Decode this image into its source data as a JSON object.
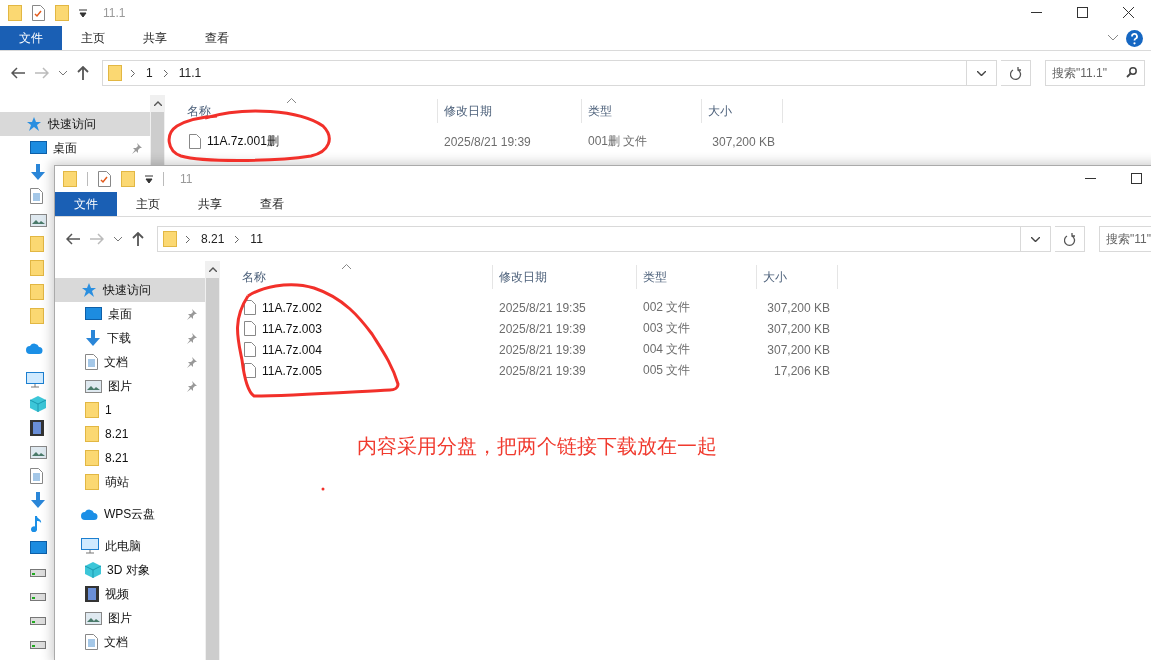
{
  "windows": [
    {
      "title": "11.1",
      "ribbon_tabs": [
        {
          "label": "文件",
          "selected": true
        },
        {
          "label": "主页",
          "selected": false
        },
        {
          "label": "共享",
          "selected": false
        },
        {
          "label": "查看",
          "selected": false
        }
      ],
      "path": [
        "1",
        "11.1"
      ],
      "search": {
        "placeholder": "搜索\"11.1\""
      },
      "sidebar": [
        {
          "kind": "star",
          "label": "快速访问",
          "selected": true,
          "children": [
            {
              "kind": "desktop",
              "label": "桌面",
              "selected": false,
              "pinned": true
            },
            {
              "kind": "download",
              "selected": false
            },
            {
              "kind": "doc",
              "selected": false
            },
            {
              "kind": "picture",
              "selected": false
            },
            {
              "kind": "folder",
              "selected": false
            },
            {
              "kind": "folder",
              "selected": false
            },
            {
              "kind": "folder",
              "selected": false
            },
            {
              "kind": "folder",
              "selected": false
            }
          ]
        },
        {
          "kind": "cloud",
          "selected": false
        },
        {
          "kind": "pc",
          "selected": false,
          "children": [
            {
              "kind": "cube",
              "selected": false
            },
            {
              "kind": "video",
              "selected": false
            },
            {
              "kind": "picture",
              "selected": false
            },
            {
              "kind": "doc",
              "selected": false
            },
            {
              "kind": "download",
              "selected": false
            },
            {
              "kind": "music",
              "selected": false
            },
            {
              "kind": "desktop",
              "selected": false
            },
            {
              "kind": "drive",
              "selected": false
            },
            {
              "kind": "drive",
              "selected": false
            },
            {
              "kind": "drive",
              "selected": false
            },
            {
              "kind": "drive",
              "selected": false
            }
          ]
        }
      ],
      "columns": [
        "名称",
        "修改日期",
        "类型",
        "大小"
      ],
      "files": [
        {
          "name": "11A.7z.001删",
          "modified": "2025/8/21 19:39",
          "type": "001删 文件",
          "size": "307,200 KB"
        }
      ]
    },
    {
      "title": "11",
      "ribbon_tabs": [
        {
          "label": "文件",
          "selected": true
        },
        {
          "label": "主页",
          "selected": false
        },
        {
          "label": "共享",
          "selected": false
        },
        {
          "label": "查看",
          "selected": false
        }
      ],
      "path": [
        "8.21",
        "11"
      ],
      "search": {
        "placeholder": "搜索\"11\""
      },
      "sidebar": [
        {
          "kind": "star",
          "label": "快速访问",
          "selected": true,
          "pinned": false,
          "children": [
            {
              "kind": "desktop",
              "label": "桌面",
              "selected": false,
              "pinned": true
            },
            {
              "kind": "download",
              "label": "下载",
              "selected": false,
              "pinned": true
            },
            {
              "kind": "doc",
              "label": "文档",
              "selected": false,
              "pinned": true
            },
            {
              "kind": "picture",
              "label": "图片",
              "selected": false,
              "pinned": true
            },
            {
              "kind": "folder",
              "label": "1",
              "selected": false,
              "pinned": false
            },
            {
              "kind": "folder",
              "label": "8.21",
              "selected": false,
              "pinned": false
            },
            {
              "kind": "folder",
              "label": "8.21",
              "selected": false,
              "pinned": false
            },
            {
              "kind": "folder",
              "label": "萌站",
              "selected": false,
              "pinned": false
            }
          ]
        },
        {
          "kind": "cloud",
          "label": "WPS云盘",
          "selected": false,
          "pinned": false
        },
        {
          "kind": "pc",
          "label": "此电脑",
          "selected": false,
          "pinned": false,
          "children": [
            {
              "kind": "cube",
              "label": "3D 对象",
              "selected": false,
              "pinned": false
            },
            {
              "kind": "video",
              "label": "视频",
              "selected": false,
              "pinned": false
            },
            {
              "kind": "picture",
              "label": "图片",
              "selected": false,
              "pinned": false
            },
            {
              "kind": "doc",
              "label": "文档",
              "selected": false,
              "pinned": false
            }
          ]
        }
      ],
      "columns": [
        "名称",
        "修改日期",
        "类型",
        "大小"
      ],
      "files": [
        {
          "name": "11A.7z.002",
          "modified": "2025/8/21 19:35",
          "type": "002 文件",
          "size": "307,200 KB"
        },
        {
          "name": "11A.7z.003",
          "modified": "2025/8/21 19:39",
          "type": "003 文件",
          "size": "307,200 KB"
        },
        {
          "name": "11A.7z.004",
          "modified": "2025/8/21 19:39",
          "type": "004 文件",
          "size": "307,200 KB"
        },
        {
          "name": "11A.7z.005",
          "modified": "2025/8/21 19:39",
          "type": "005 文件",
          "size": "17,206 KB"
        }
      ]
    }
  ],
  "annotation": {
    "note": "内容采用分盘，把两个链接下载放在一起"
  }
}
